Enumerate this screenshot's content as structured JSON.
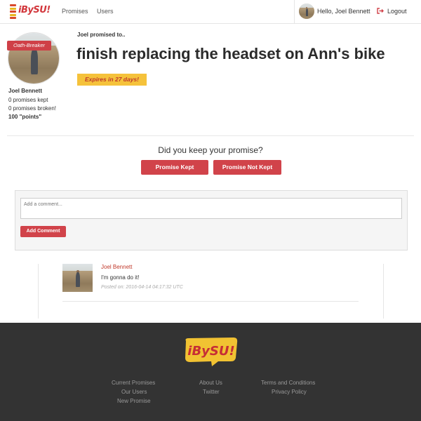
{
  "brand": {
    "name": "iBySU!"
  },
  "nav": {
    "promises_label": "Promises",
    "users_label": "Users",
    "greeting": "Hello, Joel Bennett",
    "logout_label": "Logout"
  },
  "profile": {
    "badge": "Oath-Breaker",
    "name": "Joel Bennett",
    "kept": "0 promises kept",
    "broken": "0 promises broken!",
    "points": "100 \"points\""
  },
  "promise": {
    "intro": "Joel promised to..",
    "title": "finish replacing the headset on Ann's bike",
    "expires": "Expires in 27 days!"
  },
  "keep_prompt": {
    "question": "Did you keep your promise?",
    "kept_button": "Promise Kept",
    "not_kept_button": "Promise Not Kept"
  },
  "comment_form": {
    "placeholder": "Add a comment...",
    "submit_label": "Add Comment"
  },
  "comments": [
    {
      "author": "Joel Bennett",
      "text": "I'm gonna do it!",
      "posted": "Posted on: 2016-04-14 04:17:32 UTC"
    }
  ],
  "footer": {
    "col1": [
      "Current Promises",
      "Our Users",
      "New Promise"
    ],
    "col2": [
      "About Us",
      "Twitter"
    ],
    "col3": [
      "Terms and Conditions",
      "Privacy Policy"
    ]
  },
  "colors": {
    "brand_red": "#d1434a",
    "expires_yellow": "#f5c23b",
    "footer_bg": "#333333"
  },
  "icons": [
    "logout-icon",
    "logo-icon"
  ]
}
